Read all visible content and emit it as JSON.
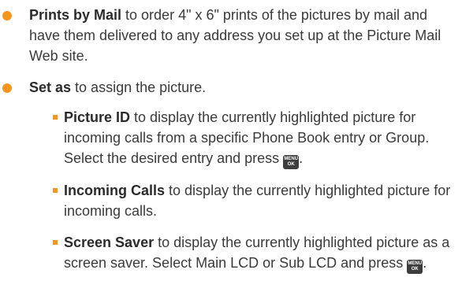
{
  "items": [
    {
      "term": "Prints by Mail",
      "text": " to order 4\" x 6\" prints of the pictures by mail and have them delivered to any address you set up at the Picture Mail Web site."
    },
    {
      "term": "Set as",
      "text": " to assign the picture.",
      "subitems": [
        {
          "term": "Picture ID",
          "text": " to display the currently highlighted picture for incoming calls from a specific Phone Book entry or Group. Select the desired entry and press ",
          "after": "."
        },
        {
          "term": "Incoming Calls",
          "text": " to display the currently highlighted picture for incoming calls."
        },
        {
          "term": "Screen Saver",
          "text": " to display the currently highlighted picture as a screen saver. Select Main LCD or Sub LCD and press ",
          "after": "."
        }
      ]
    }
  ],
  "menu_key": {
    "top": "MENU",
    "bottom": "OK"
  },
  "colors": {
    "bullet": "#f4961e",
    "text": "#3a3a3a",
    "key_background": "#3d3d3d"
  },
  "icons": {
    "main_bullet": "orange-dot",
    "sub_bullet": "orange-square",
    "menu_ok_key": "menu-ok-key-icon"
  }
}
